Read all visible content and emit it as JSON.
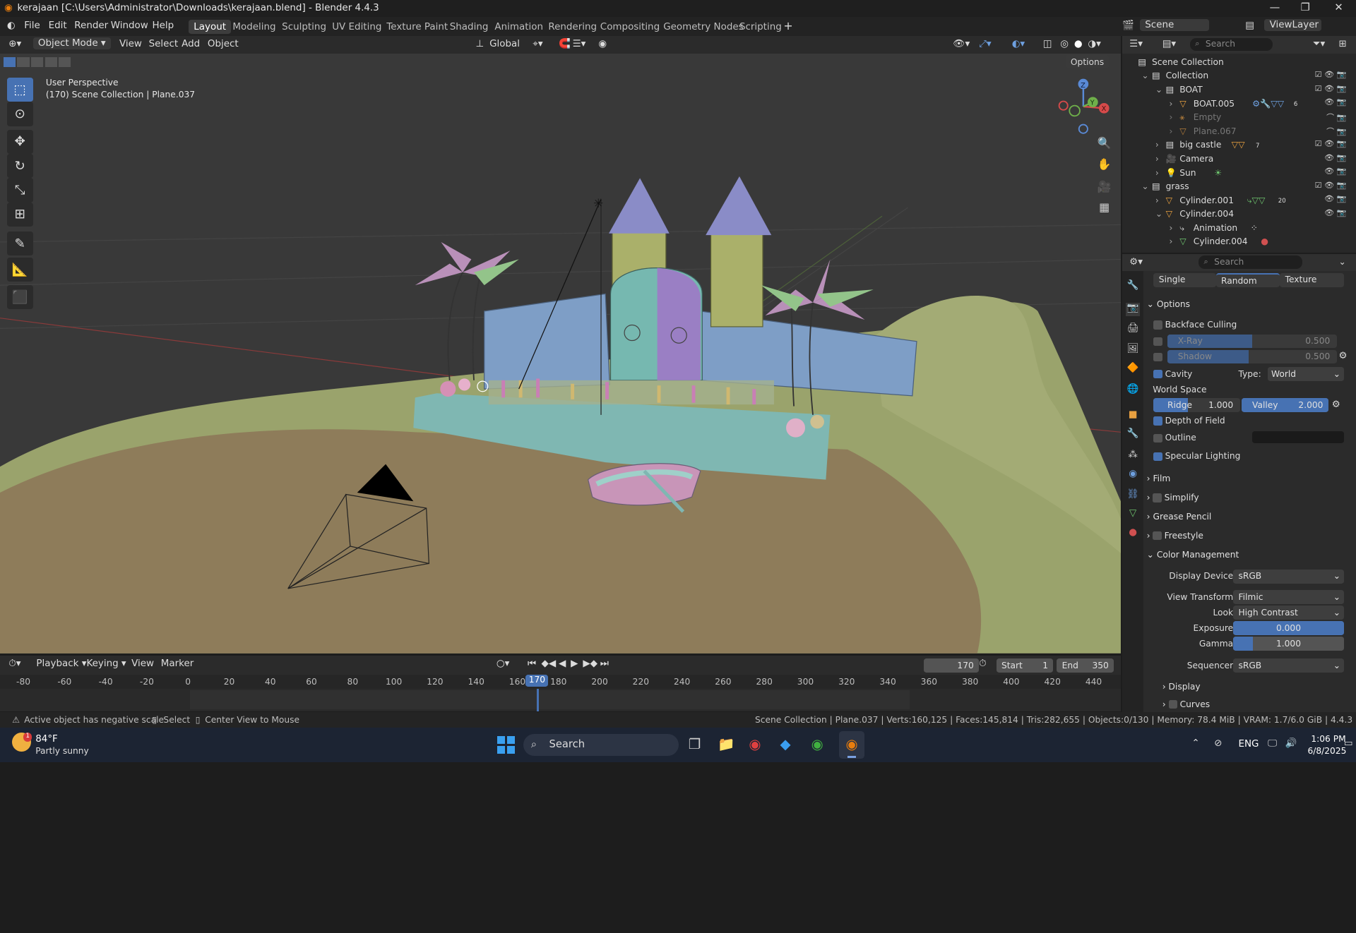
{
  "window": {
    "title": "kerajaan [C:\\Users\\Administrator\\Downloads\\kerajaan.blend] - Blender 4.4.3"
  },
  "menu": [
    "File",
    "Edit",
    "Render",
    "Window",
    "Help"
  ],
  "workspaces": [
    "Layout",
    "Modeling",
    "Sculpting",
    "UV Editing",
    "Texture Paint",
    "Shading",
    "Animation",
    "Rendering",
    "Compositing",
    "Geometry Nodes",
    "Scripting"
  ],
  "topright": {
    "scene": "Scene",
    "viewlayer": "ViewLayer"
  },
  "viewport_header": {
    "mode": "Object Mode",
    "menus": [
      "View",
      "Select",
      "Add",
      "Object"
    ],
    "transform": "Global",
    "options": "Options"
  },
  "viewport": {
    "info_line1": "User Perspective",
    "info_line2": "(170) Scene Collection | Plane.037",
    "gizmo": {
      "x": "X",
      "y": "Y",
      "z": "Z"
    }
  },
  "outliner": {
    "search_placeholder": "Search",
    "rows": [
      {
        "label": "Scene Collection"
      },
      {
        "label": "Collection"
      },
      {
        "label": "BOAT"
      },
      {
        "label": "BOAT.005",
        "badge": "6"
      },
      {
        "label": "Empty"
      },
      {
        "label": "Plane.067"
      },
      {
        "label": "big castle",
        "badge": "7"
      },
      {
        "label": "Camera"
      },
      {
        "label": "Sun"
      },
      {
        "label": "grass"
      },
      {
        "label": "Cylinder.001",
        "badge": "20"
      },
      {
        "label": "Cylinder.004"
      },
      {
        "label": "Animation"
      },
      {
        "label": "Cylinder.004"
      }
    ]
  },
  "properties": {
    "search_placeholder": "Search",
    "tabs": [
      "Single",
      "Random",
      "Texture"
    ],
    "options_header": "Options",
    "backface": "Backface Culling",
    "xray": {
      "label": "X-Ray",
      "value": "0.500"
    },
    "shadow": {
      "label": "Shadow",
      "value": "0.500"
    },
    "cavity": "Cavity",
    "type_label": "Type:",
    "type_value": "World",
    "world_space": "World Space",
    "ridge": {
      "label": "Ridge",
      "value": "1.000"
    },
    "valley": {
      "label": "Valley",
      "value": "2.000"
    },
    "dof": "Depth of Field",
    "outline": "Outline",
    "specular": "Specular Lighting",
    "film": "Film",
    "simplify": "Simplify",
    "grease": "Grease Pencil",
    "freestyle": "Freestyle",
    "color_mgmt": "Color Management",
    "display_device_label": "Display Device",
    "display_device": "sRGB",
    "view_transform_label": "View Transform",
    "view_transform": "Filmic",
    "look_label": "Look",
    "look": "High Contrast",
    "exposure_label": "Exposure",
    "exposure": "0.000",
    "gamma_label": "Gamma",
    "gamma": "1.000",
    "sequencer_label": "Sequencer",
    "sequencer": "sRGB",
    "display": "Display",
    "curves": "Curves"
  },
  "timeline": {
    "menus": [
      "Playback",
      "Keying",
      "View",
      "Marker"
    ],
    "current_frame": "170",
    "start_label": "Start",
    "start": "1",
    "end_label": "End",
    "end": "350",
    "ticks": [
      "-80",
      "-60",
      "-40",
      "-20",
      "0",
      "20",
      "40",
      "60",
      "80",
      "100",
      "120",
      "140",
      "160",
      "170",
      "180",
      "200",
      "220",
      "240",
      "260",
      "280",
      "300",
      "320",
      "340",
      "360",
      "380",
      "400",
      "420",
      "440"
    ]
  },
  "status": {
    "left": "Active object has negative scale",
    "select": "Select",
    "center": "Center View to Mouse",
    "right": "Scene Collection | Plane.037 | Verts:160,125 | Faces:145,814 | Tris:282,655 | Objects:0/130 | Memory: 78.4 MiB | VRAM: 1.7/6.0 GiB | 4.4.3"
  },
  "taskbar": {
    "weather_temp": "84°F",
    "weather_desc": "Partly sunny",
    "weather_badge": "1",
    "search": "Search",
    "lang": "ENG",
    "time": "1:06 PM",
    "date": "6/8/2025"
  },
  "colors": {
    "accent": "#4772b3",
    "ground": "#9aa36c",
    "sand": "#8e7c5a",
    "castle": "#7ea8a7"
  }
}
